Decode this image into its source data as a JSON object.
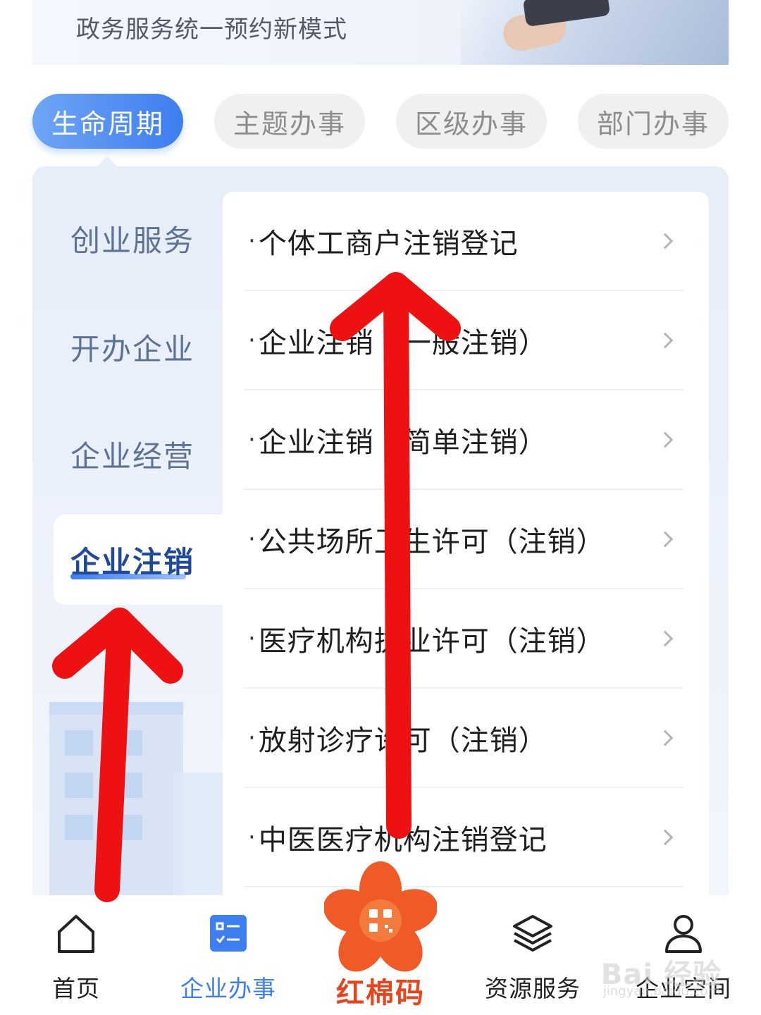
{
  "banner": {
    "subtitle": "政务服务统一预约新模式"
  },
  "tabs": [
    {
      "label": "生命周期",
      "active": true
    },
    {
      "label": "主题办事",
      "active": false
    },
    {
      "label": "区级办事",
      "active": false
    },
    {
      "label": "部门办事",
      "active": false
    }
  ],
  "sidebar": {
    "items": [
      {
        "label": "创业服务",
        "active": false
      },
      {
        "label": "开办企业",
        "active": false
      },
      {
        "label": "企业经营",
        "active": false
      },
      {
        "label": "企业注销",
        "active": true
      }
    ]
  },
  "list": {
    "bullet": "·",
    "items": [
      {
        "label": "个体工商户注销登记"
      },
      {
        "label": "企业注销（一般注销）"
      },
      {
        "label": "企业注销（简单注销）"
      },
      {
        "label": "公共场所卫生许可（注销）"
      },
      {
        "label": "医疗机构执业许可（注销）"
      },
      {
        "label": "放射诊疗许可（注销）"
      },
      {
        "label": "中医医疗机构注销登记"
      }
    ]
  },
  "bottom_nav": {
    "items": [
      {
        "label": "首页",
        "icon": "home-icon",
        "active": false
      },
      {
        "label": "企业办事",
        "icon": "checklist-icon",
        "active": true
      },
      {
        "label": "红棉码",
        "icon": "kapok-flower-qr-icon",
        "active": false
      },
      {
        "label": "资源服务",
        "icon": "layers-icon",
        "active": false
      },
      {
        "label": "企业空间",
        "icon": "user-icon",
        "active": false
      }
    ]
  },
  "watermark": {
    "text": "Bai 经验",
    "sub": "jingyan.baidu.com"
  },
  "colors": {
    "accent": "#3d7ef0",
    "annotation_arrow": "#ee1111",
    "brand_orange": "#e9431c"
  }
}
